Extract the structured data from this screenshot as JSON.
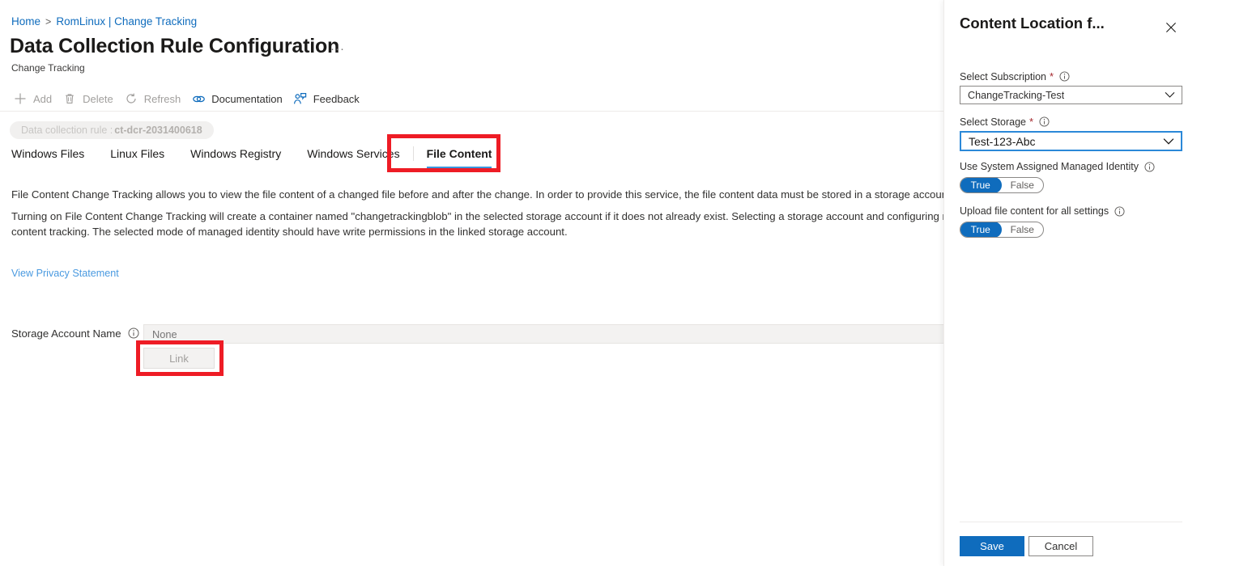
{
  "breadcrumb": {
    "home": "Home",
    "separator": ">",
    "current": "RomLinux | Change Tracking"
  },
  "header": {
    "title": "Data Collection Rule Configuration",
    "ellipsis": "···",
    "subtitle": "Change Tracking"
  },
  "commandbar": {
    "items": [
      {
        "label": "Add",
        "icon": "plus-icon",
        "disabled": true
      },
      {
        "label": "Delete",
        "icon": "trash-icon",
        "disabled": true
      },
      {
        "label": "Refresh",
        "icon": "refresh-icon",
        "disabled": true
      },
      {
        "label": "Documentation",
        "icon": "link-chain-icon",
        "disabled": false
      },
      {
        "label": "Feedback",
        "icon": "feedback-person-icon",
        "disabled": false
      }
    ]
  },
  "dcr_chip": {
    "prefix": "Data collection rule : ",
    "value": "ct-dcr-2031400618"
  },
  "tabs": [
    {
      "label": "Windows Files",
      "active": false
    },
    {
      "label": "Linux Files",
      "active": false
    },
    {
      "label": "Windows Registry",
      "active": false
    },
    {
      "label": "Windows Services",
      "active": false
    },
    {
      "label": "File Content",
      "active": true
    }
  ],
  "content": {
    "paragraph_1": "File Content Change Tracking allows you to view the file content of a changed file before and after the change. In order to provide this service, the file content data must be stored in a storage account",
    "paragraph_2": "Turning on File Content Change Tracking will create a container named \"changetrackingblob\" in the selected storage account if it does not already exist. Selecting a storage account and configuring managed identity is mandatory for file content tracking. The selected mode of managed identity should have write permissions in the linked storage account.",
    "privacy_link": "View Privacy Statement",
    "storage_account_label": "Storage Account Name",
    "storage_account_value": "",
    "storage_account_placeholder": "None",
    "link_button": "Link"
  },
  "annotations": {
    "accent_color": "#ee1c25",
    "boxes": [
      {
        "name": "file-content-tab-highlight"
      },
      {
        "name": "link-button-highlight"
      }
    ]
  },
  "panel": {
    "title": "Content Location f...",
    "close_icon": "close-icon",
    "subscription": {
      "label": "Select Subscription",
      "required": "*",
      "info_icon": "info-icon",
      "value": "ChangeTracking-Test"
    },
    "storage": {
      "label": "Select Storage",
      "required": "*",
      "info_icon": "info-icon",
      "value": "Test-123-Abc"
    },
    "managed_identity": {
      "label": "Use System Assigned Managed Identity",
      "info_icon": "info-icon",
      "on_label": "True",
      "off_label": "False",
      "selected": "True"
    },
    "upload_all": {
      "label": "Upload file content for all settings",
      "info_icon": "info-icon",
      "on_label": "True",
      "off_label": "False",
      "selected": "True"
    },
    "save_label": "Save",
    "cancel_label": "Cancel"
  },
  "colors": {
    "accent_blue": "#0f6cbd",
    "link_blue": "#4a9ae0",
    "tab_underline": "#3a96dd",
    "focus_border": "#2b88d8",
    "required_red": "#a4262c",
    "annotation_red": "#ee1c25"
  }
}
